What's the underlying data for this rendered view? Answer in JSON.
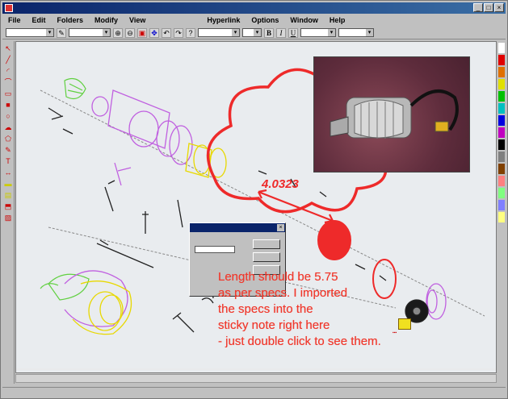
{
  "window": {
    "title": "",
    "controls": [
      "_",
      "□",
      "×"
    ]
  },
  "menu": {
    "items": [
      "File",
      "Edit",
      "Folders",
      "Modify",
      "View",
      "Hyperlink",
      "Options",
      "Window",
      "Help"
    ]
  },
  "toolbar": {
    "combo1": "",
    "combo2": "",
    "combo3": "",
    "combo4": "",
    "font_size": "",
    "bold_label": "B",
    "italic_label": "I",
    "underline_label": "U"
  },
  "canvas": {
    "dimension_value": "4.0323",
    "note_lines": [
      "Length should be 5.75",
      "as per specs. I imported",
      "the specs into the",
      "sticky note right here",
      "- just double click to see them."
    ]
  },
  "dialog": {
    "title": "",
    "field_label": "",
    "field_value": "",
    "buttons": [
      "",
      "",
      ""
    ]
  },
  "status": {
    "zoom": "",
    "coords": "",
    "mode": ""
  },
  "colors": {
    "markup_red": "#f03a2e",
    "assembly_magenta": "#c060e0",
    "assembly_yellow": "#f0e020",
    "assembly_green": "#60d040",
    "titlebar_blue": "#0a246a"
  },
  "palette": [
    "#ffffff",
    "#e00000",
    "#e07000",
    "#e0e000",
    "#00c000",
    "#00c0c0",
    "#0000e0",
    "#c000c0",
    "#000000",
    "#808080",
    "#804000",
    "#ff8080",
    "#80ff80",
    "#8080ff",
    "#ffff80"
  ]
}
